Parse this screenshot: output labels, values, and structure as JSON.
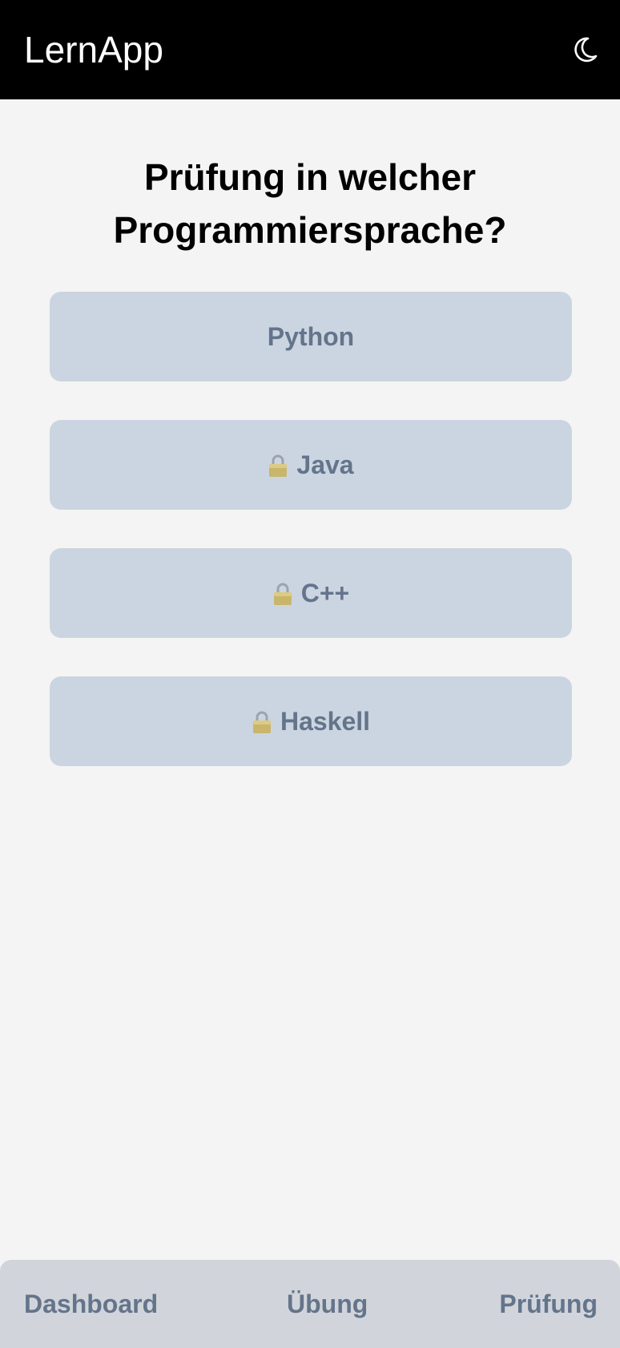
{
  "header": {
    "app_title": "LernApp",
    "theme_icon": "moon-icon"
  },
  "main": {
    "title": "Prüfung in welcher Programmiersprache?",
    "languages": [
      {
        "label": "Python",
        "locked": false
      },
      {
        "label": "Java",
        "locked": true,
        "icon": "lock-icon"
      },
      {
        "label": "C++",
        "locked": true,
        "icon": "lock-icon"
      },
      {
        "label": "Haskell",
        "locked": true,
        "icon": "lock-icon"
      }
    ]
  },
  "bottom_nav": {
    "items": [
      {
        "label": "Dashboard"
      },
      {
        "label": "Übung"
      },
      {
        "label": "Prüfung"
      }
    ]
  },
  "colors": {
    "header_bg": "#000000",
    "page_bg": "#f4f4f4",
    "button_bg": "#cbd5e1",
    "button_text": "#64748b",
    "nav_bg": "#d1d5db"
  }
}
